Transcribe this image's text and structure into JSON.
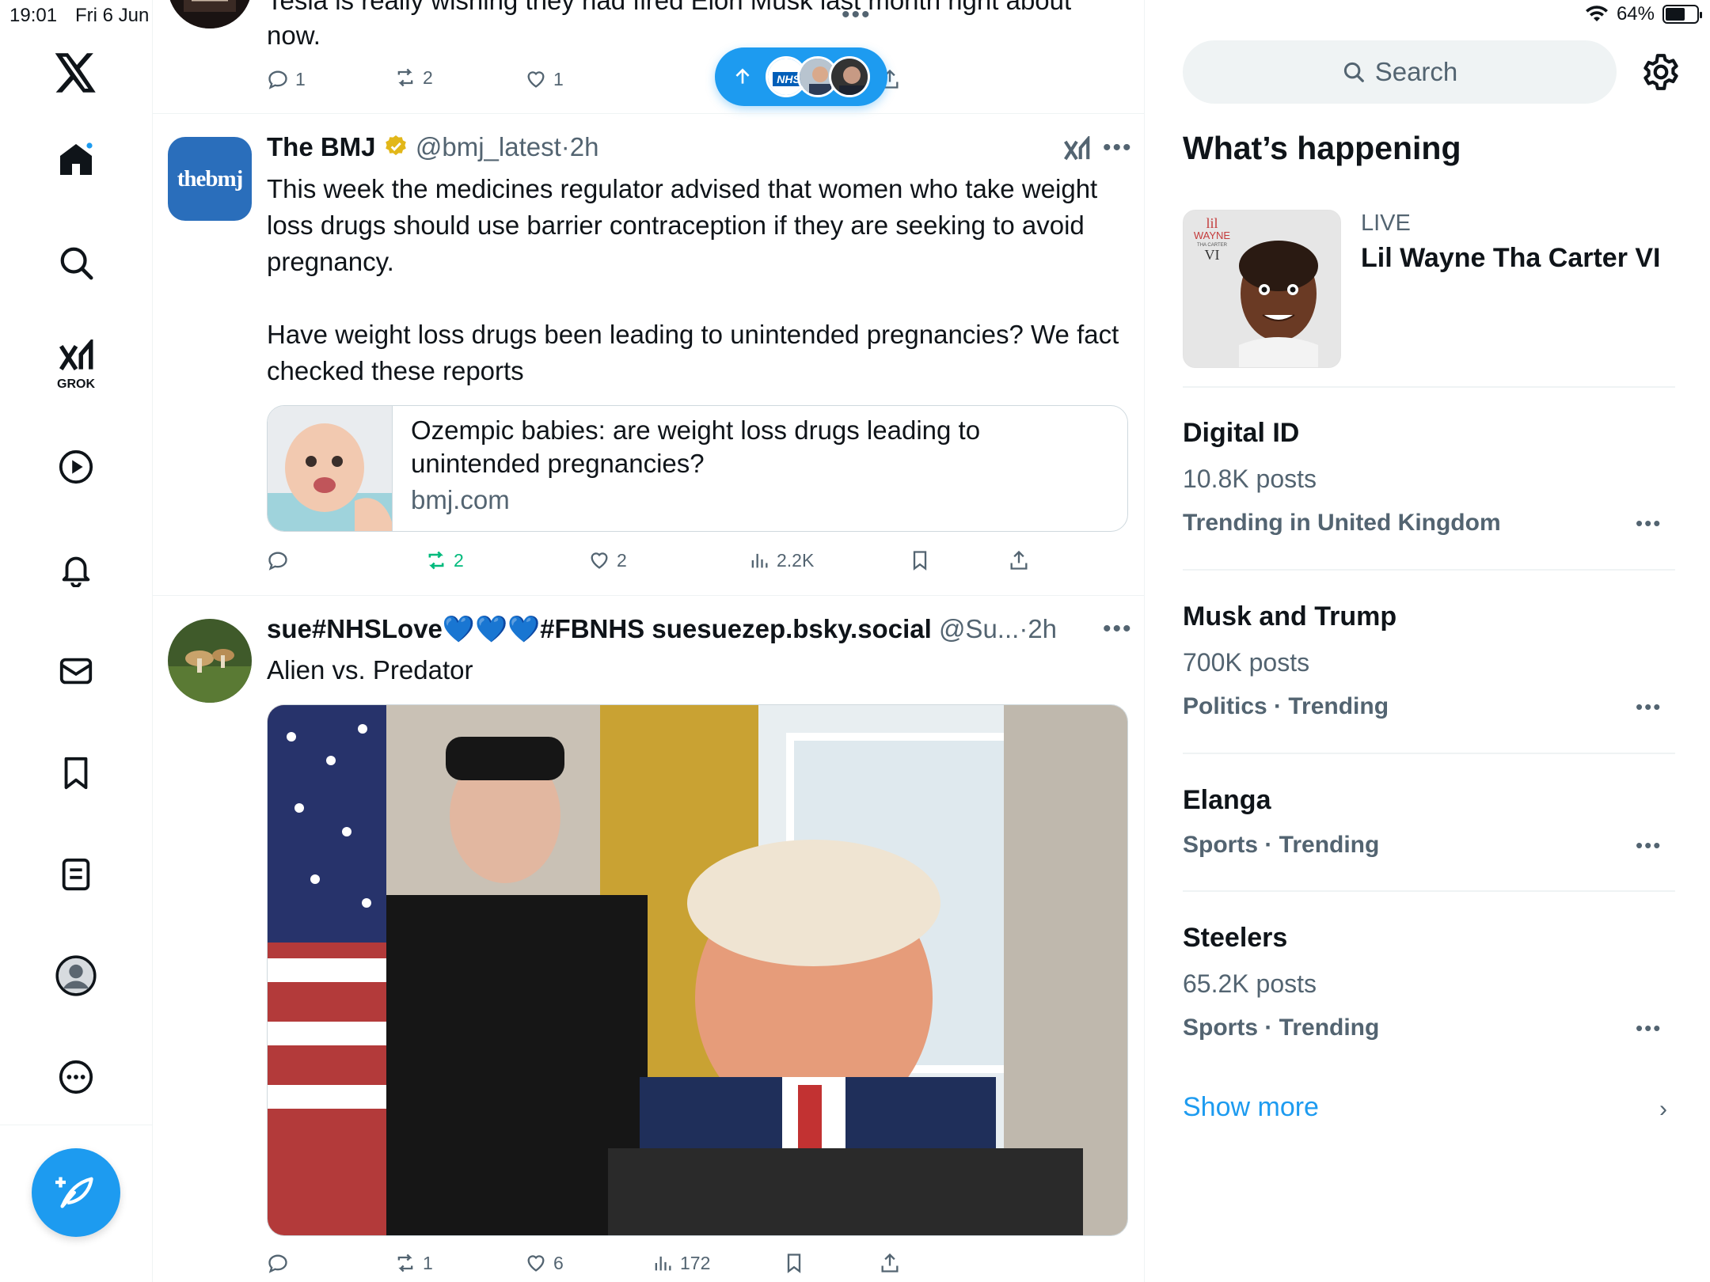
{
  "status": {
    "time": "19:01",
    "date": "Fri 6 Jun",
    "battery": "64%",
    "battery_level": 0.64
  },
  "prev_tweet": {
    "text_line1": "Tesla is really wishing they had fired Elon Musk last month right about",
    "text_line2": "now.",
    "replies": "1",
    "reposts": "2",
    "likes": "1"
  },
  "toast": {
    "icon": "arrow-up-icon"
  },
  "tweet1": {
    "display_name": "The BMJ",
    "handle": "@bmj_latest",
    "sep": "·",
    "time": "2h",
    "avatar_text": "thebmj",
    "paragraph1": "This week the medicines regulator advised that women who take weight loss drugs should use barrier contraception if they are seeking to avoid pregnancy.",
    "paragraph2": "Have weight loss drugs been leading to unintended pregnancies? We fact checked these reports",
    "card_title": "Ozempic babies: are weight loss drugs leading to unintended pregnancies?",
    "card_domain": "bmj.com",
    "reposts": "2",
    "likes": "2",
    "views": "2.2K"
  },
  "tweet2": {
    "display_name": "sue#NHSLove💙💙💙#FBNHS suesuezep.bsky.social",
    "handle": "@Su...",
    "sep": "·",
    "time": "2h",
    "text": "Alien vs. Predator",
    "reposts": "1",
    "likes": "6",
    "views": "172"
  },
  "sidebar": {
    "search_placeholder": "Search",
    "heading": "What’s happening",
    "live_label": "LIVE",
    "live_title": "Lil Wayne Tha Carter VI",
    "album_text_1": "lil",
    "album_text_2": "WAYNE",
    "album_text_3": "THA CARTER",
    "album_text_4": "VI",
    "trends": [
      {
        "title": "Digital ID",
        "posts": "10.8K posts",
        "context": "Trending in United Kingdom"
      },
      {
        "title": "Musk and Trump",
        "posts": "700K posts",
        "context": "Politics · Trending"
      },
      {
        "title": "Elanga",
        "posts": "",
        "context": "Sports · Trending"
      },
      {
        "title": "Steelers",
        "posts": "65.2K posts",
        "context": "Sports · Trending"
      }
    ],
    "show_more": "Show more"
  },
  "nav": {
    "grok_label": "GROK"
  },
  "colors": {
    "accent": "#1d9bf0",
    "repost_active": "#00ba7c",
    "bmj_blue": "#2a6ebb"
  }
}
